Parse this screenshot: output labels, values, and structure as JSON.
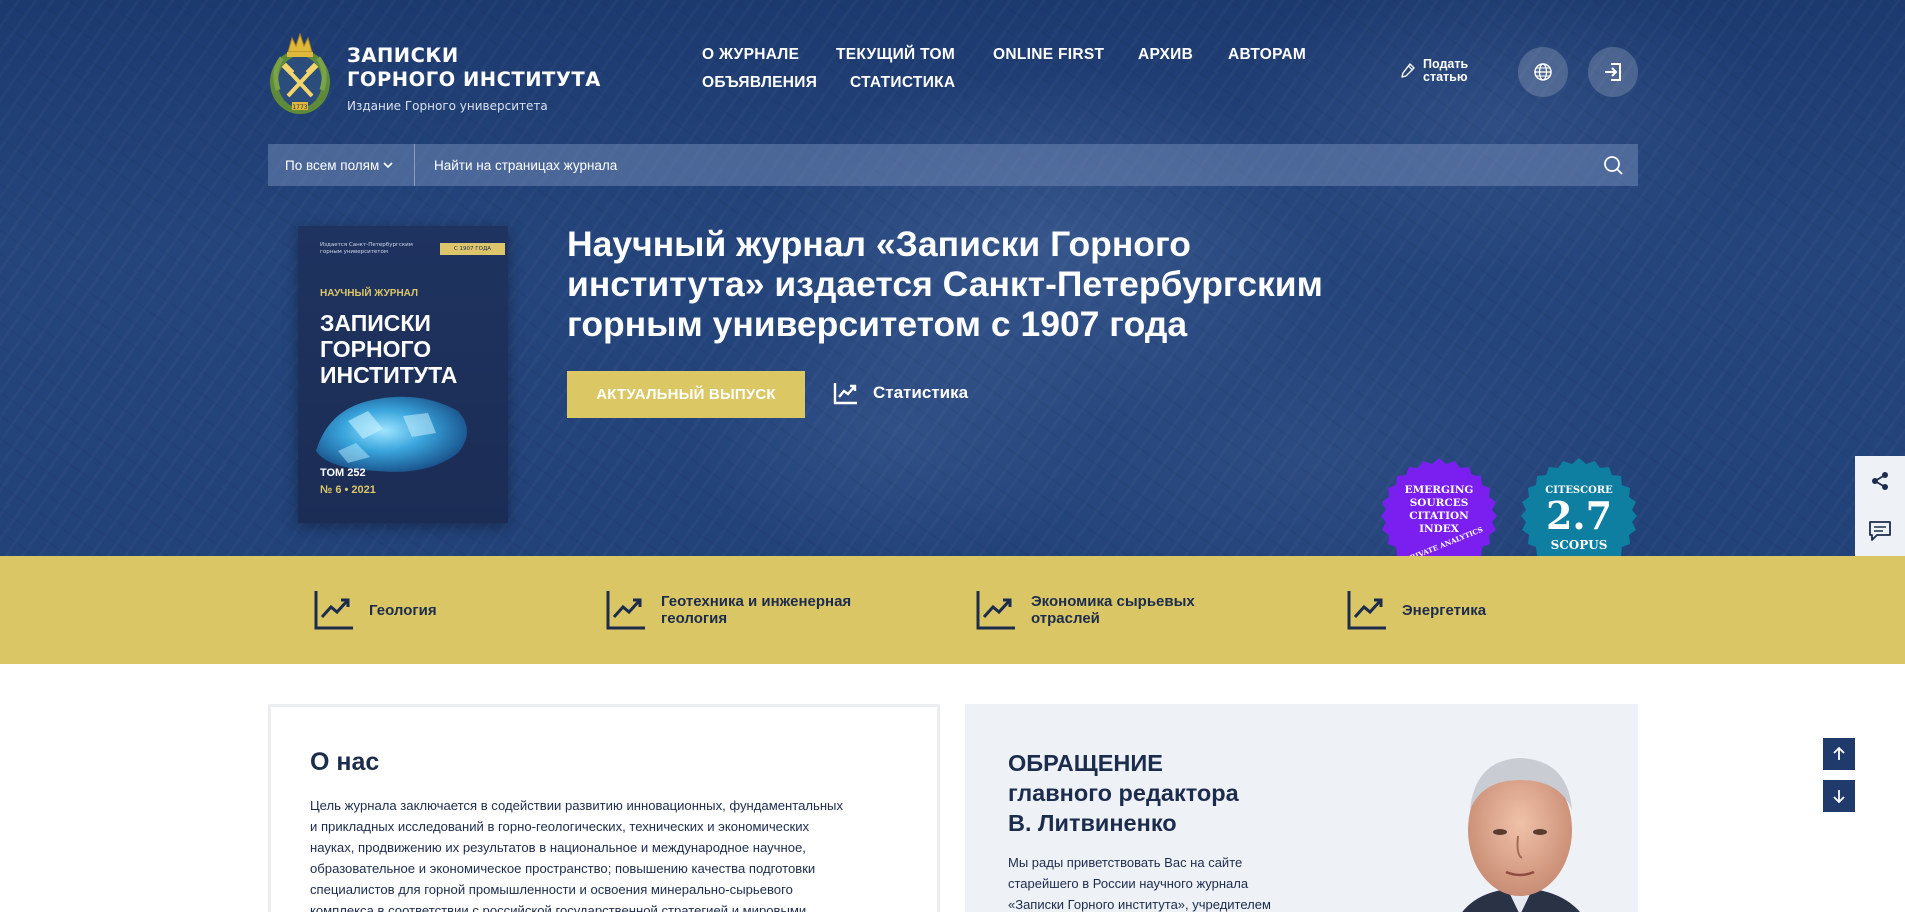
{
  "header": {
    "logo_icon": "crown-crossed-hammers-emblem",
    "logo_year": "1773",
    "title_line1": "ЗАПИСКИ",
    "title_line2": "ГОРНОГО ИНСТИТУТА",
    "subtitle": "Издание Горного университета",
    "nav": [
      {
        "label": "О ЖУРНАЛЕ"
      },
      {
        "label": "ТЕКУЩИЙ ТОМ"
      },
      {
        "label": "ONLINE FIRST"
      },
      {
        "label": "АРХИВ"
      },
      {
        "label": "АВТОРАМ"
      },
      {
        "label": "ОБЪЯВЛЕНИЯ"
      },
      {
        "label": "СТАТИСТИКА"
      }
    ],
    "submit_line1": "Подать",
    "submit_line2": "статью",
    "submit_icon": "pen-icon",
    "language_icon": "globe-icon",
    "login_icon": "login-icon"
  },
  "search": {
    "scope_label": "По всем полям",
    "placeholder": "Найти на страницах журнала",
    "search_icon": "search-icon"
  },
  "cover": {
    "publisher": "Издается Санкт-Петербургским горным университетом",
    "since": "С 1907 ГОДА",
    "kind": "НАУЧНЫЙ ЖУРНАЛ",
    "title_line1": "ЗАПИСКИ",
    "title_line2": "ГОРНОГО",
    "title_line3": "ИНСТИТУТА",
    "volume": "ТОМ 252",
    "issue": "№ 6 • 2021"
  },
  "hero": {
    "title_line1": "Научный журнал «Записки Горного",
    "title_line2": "института» издается Санкт-Петербургским",
    "title_line3": "горным университетом с 1907 года",
    "cta_label": "АКТУАЛЬНЫЙ ВЫПУСК",
    "stats_label": "Статистика"
  },
  "badges": {
    "esci_line1": "EMERGING",
    "esci_line2": "SOURCES",
    "esci_line3": "CITATION",
    "esci_line4": "INDEX",
    "esci_line5": "CLARIVATE ANALYTICS",
    "esci_color": "#7b1ff0",
    "citescore_label": "CITESCORE",
    "citescore_value": "2.7",
    "citescore_source": "SCOPUS",
    "citescore_color": "#0e7ea1"
  },
  "side_panel": {
    "share_icon": "share-icon",
    "comment_icon": "comment-icon"
  },
  "categories": [
    {
      "line1": "Геология",
      "line2": "",
      "icon": "chart-trend-icon"
    },
    {
      "line1": "Геотехника и инженерная",
      "line2": "геология",
      "icon": "chart-trend-icon"
    },
    {
      "line1": "Экономика сырьевых",
      "line2": "отраслей",
      "icon": "chart-trend-icon"
    },
    {
      "line1": "Энергетика",
      "line2": "",
      "icon": "chart-trend-icon"
    }
  ],
  "about": {
    "title": "О нас",
    "lines": [
      "Цель журнала заключается в содействии развитию инновационных, фундаментальных",
      "и прикладных исследований в горно-геологических, технических и экономических",
      "науках, продвижению их результатов в национальное и международное научное,",
      "образовательное и экономическое пространство; повышению качества подготовки",
      "специалистов для горной промышленности и освоения минерально-сырьевого",
      "комплекса в соответствии с российской государственной стратегией и мировыми"
    ]
  },
  "editor": {
    "title_line1": "ОБРАЩЕНИЕ",
    "title_line2": "главного редактора",
    "title_line3": "В. Литвиненко",
    "lines": [
      "Мы рады приветствовать Вас на сайте",
      "старейшего в России научного журнала",
      "«Записки Горного института», учредителем"
    ]
  },
  "scroll": {
    "up_icon": "arrow-up-icon",
    "down_icon": "arrow-down-icon"
  },
  "colors": {
    "navy": "#1f3a6b",
    "gold": "#dac665",
    "accent_text": "#1c2c4c"
  }
}
